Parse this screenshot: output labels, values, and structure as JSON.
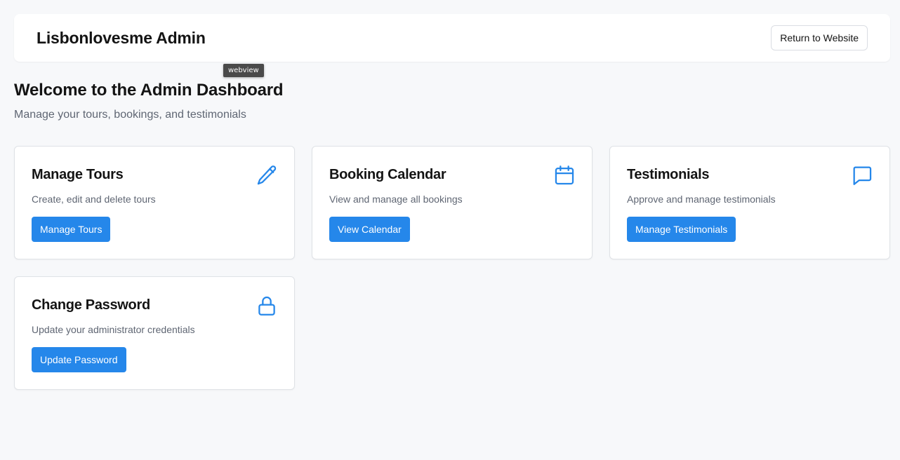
{
  "header": {
    "title": "Lisbonlovesme Admin",
    "return_label": "Return to Website"
  },
  "tooltip": {
    "text": "webview"
  },
  "welcome": {
    "title": "Welcome to the Admin Dashboard",
    "subtitle": "Manage your tours, bookings, and testimonials"
  },
  "cards": [
    {
      "title": "Manage Tours",
      "description": "Create, edit and delete tours",
      "button": "Manage Tours",
      "icon": "pencil-icon"
    },
    {
      "title": "Booking Calendar",
      "description": "View and manage all bookings",
      "button": "View Calendar",
      "icon": "calendar-icon"
    },
    {
      "title": "Testimonials",
      "description": "Approve and manage testimonials",
      "button": "Manage Testimonials",
      "icon": "chat-bubble-icon"
    },
    {
      "title": "Change Password",
      "description": "Update your administrator credentials",
      "button": "Update Password",
      "icon": "lock-icon"
    }
  ],
  "colors": {
    "accent": "#2587ea",
    "background": "#f7f8fa",
    "card": "#ffffff",
    "muted_text": "#5f6673"
  }
}
